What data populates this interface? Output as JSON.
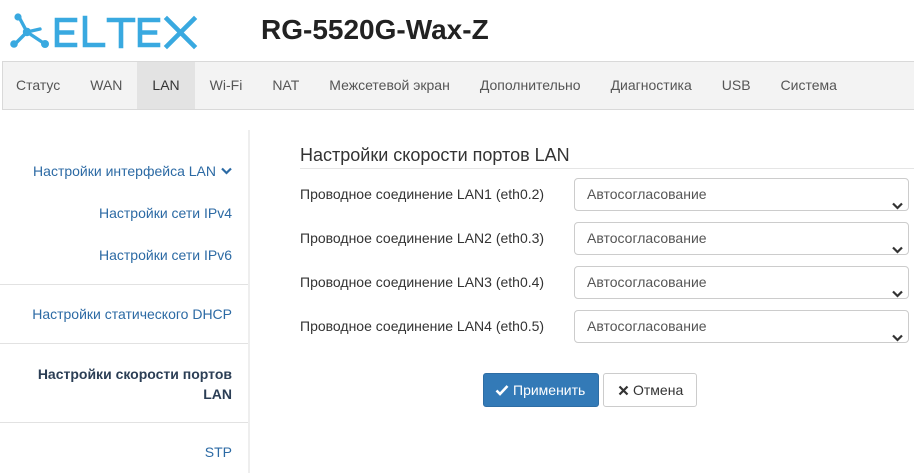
{
  "header": {
    "logo_text": "ELTEX",
    "device_title": "RG-5520G-Wax-Z"
  },
  "topnav": {
    "tabs": [
      {
        "label": "Статус"
      },
      {
        "label": "WAN"
      },
      {
        "label": "LAN"
      },
      {
        "label": "Wi-Fi"
      },
      {
        "label": "NAT"
      },
      {
        "label": "Межсетевой экран"
      },
      {
        "label": "Дополнительно"
      },
      {
        "label": "Диагностика"
      },
      {
        "label": "USB"
      },
      {
        "label": "Система"
      }
    ],
    "active": "LAN"
  },
  "sidebar": {
    "items": [
      {
        "label": "Настройки интерфейса LAN",
        "icon": "chevron-down-icon"
      },
      {
        "label": "Настройки сети IPv4"
      },
      {
        "label": "Настройки сети IPv6"
      },
      {
        "label": "Настройки статического DHCP"
      },
      {
        "label": "Настройки скорости портов",
        "label2": "LAN",
        "active": true
      },
      {
        "label": "STP"
      }
    ]
  },
  "main": {
    "title": "Настройки скорости портов LAN",
    "rows": [
      {
        "label": "Проводное соединение LAN1 (eth0.2)",
        "value": "Автосогласование"
      },
      {
        "label": "Проводное соединение LAN2 (eth0.3)",
        "value": "Автосогласование"
      },
      {
        "label": "Проводное соединение LAN3 (eth0.4)",
        "value": "Автосогласование"
      },
      {
        "label": "Проводное соединение LAN4 (eth0.5)",
        "value": "Автосогласование"
      }
    ],
    "apply_label": "Применить",
    "cancel_label": "Отмена"
  },
  "colors": {
    "brand": "#39a9e0",
    "link": "#2c6aa4",
    "primary": "#337ab7"
  }
}
